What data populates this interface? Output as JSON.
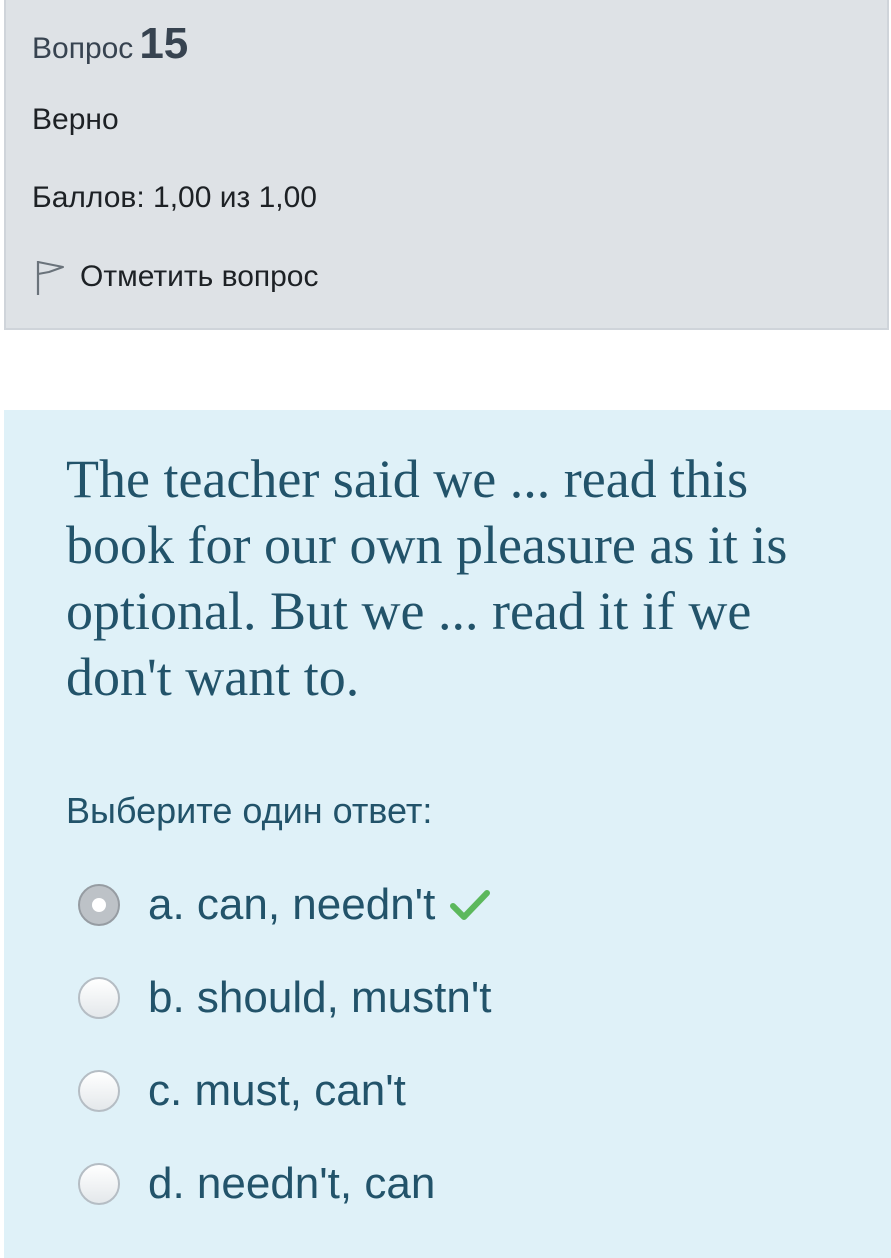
{
  "info": {
    "question_label": "Вопрос",
    "question_number": "15",
    "state": "Верно",
    "grade": "Баллов: 1,00 из 1,00",
    "flag_label": "Отметить вопрос",
    "flag_icon": "flag-outline-icon"
  },
  "question": {
    "text": "The teacher said we ... read this book for our own pleasure as it is optional. But we ... read it if we don't want to.",
    "prompt": "Выберите один ответ:",
    "options": [
      {
        "label": "a. can, needn't",
        "selected": true,
        "correct": true
      },
      {
        "label": "b. should, mustn't",
        "selected": false
      },
      {
        "label": "c. must, can't",
        "selected": false
      },
      {
        "label": "d. needn't, can",
        "selected": false
      }
    ]
  },
  "colors": {
    "info_bg": "#dee2e6",
    "content_bg": "#dff1f8",
    "text_teal": "#22536a",
    "check_green": "#5cb85c"
  },
  "icons": {
    "correct": "checkmark-icon"
  }
}
